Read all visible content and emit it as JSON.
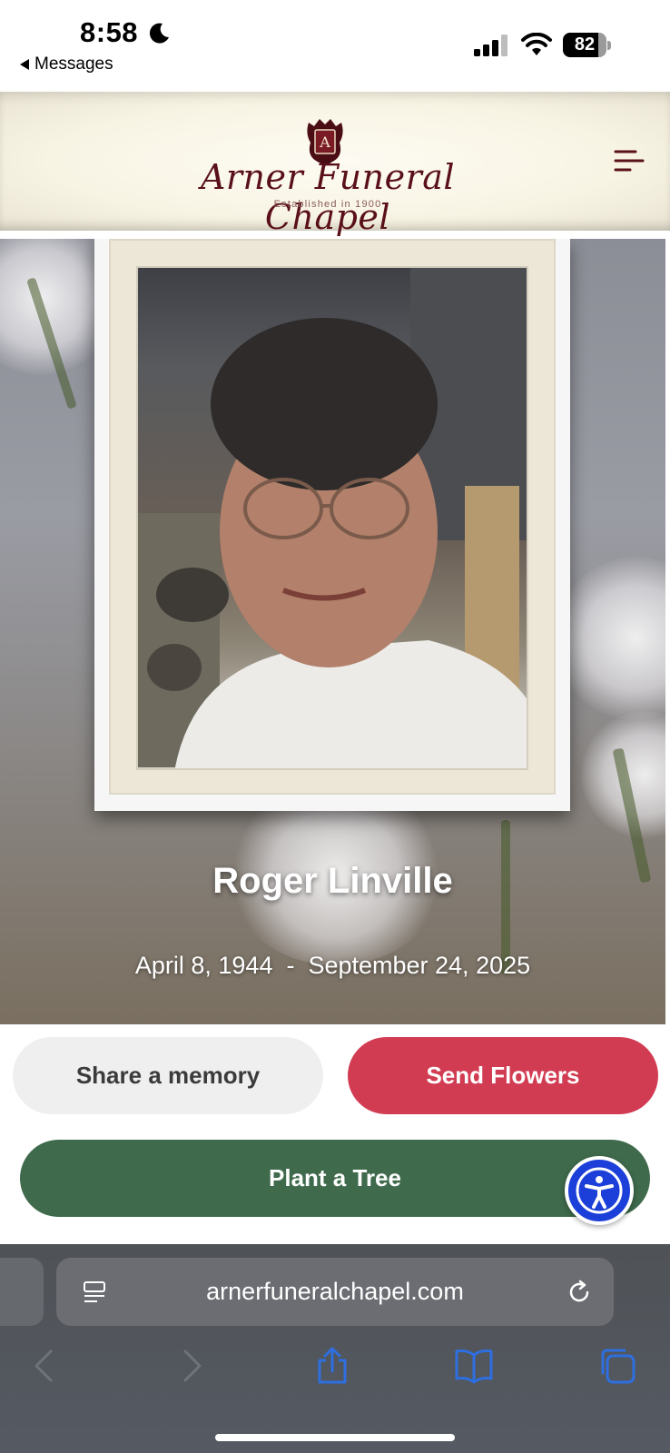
{
  "status_bar": {
    "time": "8:58",
    "back_app": "Messages",
    "battery_level": "82",
    "battery_fraction": 0.82
  },
  "header": {
    "logo_text": "Arner Funeral Chapel",
    "tagline": "Established in 1900",
    "crest_letter": "A"
  },
  "hero": {
    "name": "Roger Linville",
    "dates": "April 8, 1944  -  September 24, 2025"
  },
  "actions": {
    "share_label": "Share a memory",
    "flowers_label": "Send Flowers",
    "tree_label": "Plant a Tree"
  },
  "browser": {
    "url": "arnerfuneralchapel.com"
  },
  "colors": {
    "flowers_button": "#d23c52",
    "tree_button": "#3f6a4c",
    "accessibility_button": "#1b3fd8",
    "brand_maroon": "#5a1019"
  },
  "icons": [
    "moon-icon",
    "signal-icon",
    "wifi-icon",
    "battery-icon",
    "menu-icon",
    "accessibility-icon",
    "reader-icon",
    "reload-icon",
    "back-icon",
    "forward-icon",
    "share-icon",
    "bookmarks-icon",
    "tabs-icon"
  ]
}
